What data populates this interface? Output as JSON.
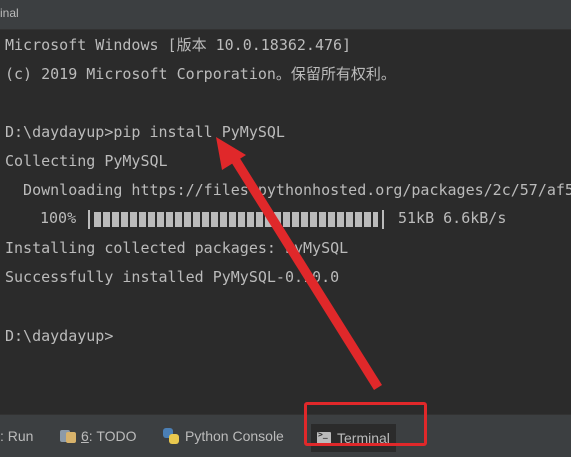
{
  "window": {
    "title": "inal"
  },
  "terminal": {
    "lines": [
      "Microsoft Windows [版本 10.0.18362.476]",
      "(c) 2019 Microsoft Corporation。保留所有权利。",
      "D:\\daydayup>pip install PyMySQL",
      "Collecting PyMySQL",
      "  Downloading https://files.pythonhosted.org/packages/2c/57/af5",
      "Installing collected packages: PyMySQL",
      "Successfully installed PyMySQL-0.10.0",
      "D:\\daydayup>"
    ],
    "progress": {
      "percent_label": "100%",
      "fraction": 1.0,
      "stats": "51kB 6.6kB/s"
    }
  },
  "toolbar": {
    "run": {
      "label": ": Run"
    },
    "todo": {
      "num": "6",
      "rest": ": TODO"
    },
    "python_console": {
      "label": "Python Console"
    },
    "terminal": {
      "label": "Terminal"
    }
  },
  "annotation": {
    "color": "#e0282a"
  }
}
